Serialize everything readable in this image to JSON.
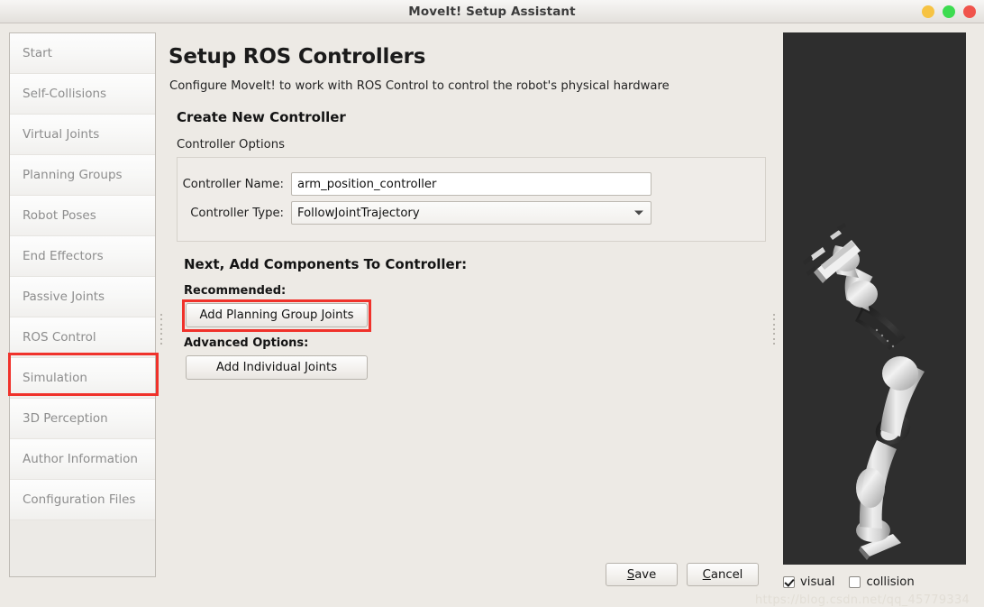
{
  "window": {
    "title": "MoveIt! Setup Assistant",
    "controls": [
      {
        "name": "minimize",
        "color": "#f6c343"
      },
      {
        "name": "maximize",
        "color": "#3ddc50"
      },
      {
        "name": "close",
        "color": "#f0544c"
      }
    ]
  },
  "sidebar": {
    "items": [
      {
        "label": "Start",
        "selected": false
      },
      {
        "label": "Self-Collisions",
        "selected": false
      },
      {
        "label": "Virtual Joints",
        "selected": false
      },
      {
        "label": "Planning Groups",
        "selected": false
      },
      {
        "label": "Robot Poses",
        "selected": false
      },
      {
        "label": "End Effectors",
        "selected": false
      },
      {
        "label": "Passive Joints",
        "selected": false
      },
      {
        "label": "ROS Control",
        "selected": true
      },
      {
        "label": "Simulation",
        "selected": false
      },
      {
        "label": "3D Perception",
        "selected": false
      },
      {
        "label": "Author Information",
        "selected": false
      },
      {
        "label": "Configuration Files",
        "selected": false
      }
    ]
  },
  "main": {
    "title": "Setup ROS Controllers",
    "subtitle": "Configure MoveIt! to work with ROS Control to control the robot's physical hardware",
    "create_section_title": "Create New Controller",
    "controller_options_label": "Controller Options",
    "form": {
      "name_label": "Controller Name:",
      "name_value": "arm_position_controller",
      "name_placeholder": "",
      "type_label": "Controller Type:",
      "type_value": "FollowJointTrajectory"
    },
    "next_section_title": "Next, Add Components To Controller:",
    "recommended_label": "Recommended:",
    "advanced_label": "Advanced Options:",
    "add_planning_group_button": "Add Planning Group Joints",
    "add_individual_button": "Add Individual Joints",
    "save_button": {
      "prefix": "",
      "mnemonic": "S",
      "suffix": "ave"
    },
    "cancel_button": {
      "prefix": "",
      "mnemonic": "C",
      "suffix": "ancel"
    }
  },
  "viewport": {
    "background_color": "#2e2e2e",
    "robot_color": "#e8e8e8"
  },
  "display_options": {
    "visual": {
      "label": "visual",
      "checked": true
    },
    "collision": {
      "label": "collision",
      "checked": false
    }
  },
  "watermark": "https://blog.csdn.net/qq_45779334",
  "highlight_color": "#f0322b"
}
